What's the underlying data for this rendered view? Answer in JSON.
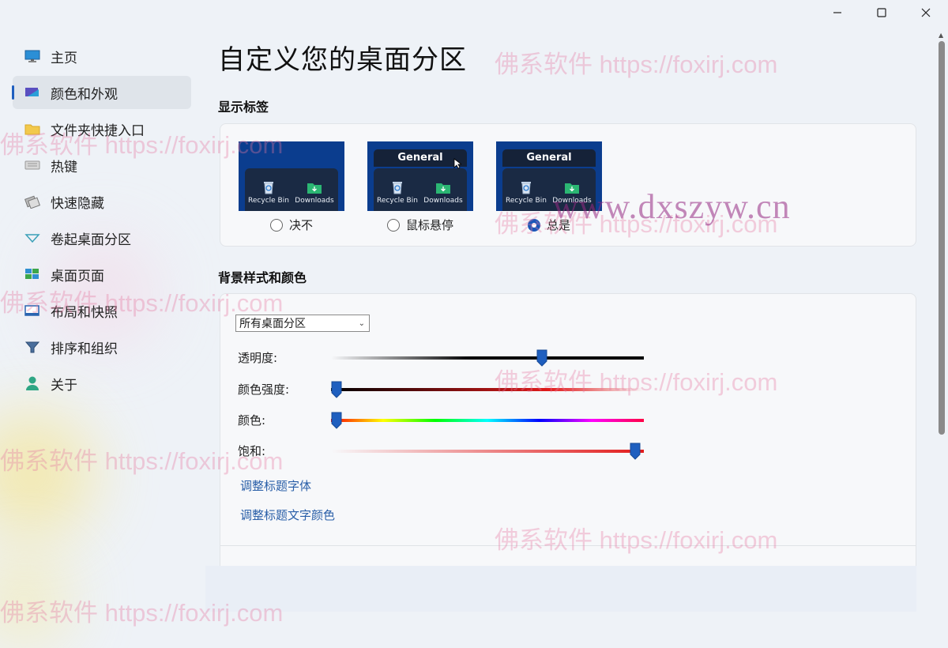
{
  "window": {
    "controls": [
      "minimize",
      "maximize",
      "close"
    ]
  },
  "sidebar": {
    "items": [
      {
        "label": "主页",
        "icon": "monitor-icon",
        "active": false
      },
      {
        "label": "颜色和外观",
        "icon": "palette-icon",
        "active": true
      },
      {
        "label": "文件夹快捷入口",
        "icon": "folder-icon",
        "active": false
      },
      {
        "label": "热键",
        "icon": "keyboard-icon",
        "active": false
      },
      {
        "label": "快速隐藏",
        "icon": "quick-hide-icon",
        "active": false
      },
      {
        "label": "卷起桌面分区",
        "icon": "rollup-icon",
        "active": false
      },
      {
        "label": "桌面页面",
        "icon": "desktop-pages-icon",
        "active": false
      },
      {
        "label": "布局和快照",
        "icon": "layout-icon",
        "active": false
      },
      {
        "label": "排序和组织",
        "icon": "sort-filter-icon",
        "active": false
      },
      {
        "label": "关于",
        "icon": "person-icon",
        "active": false
      }
    ]
  },
  "main": {
    "title": "自定义您的桌面分区",
    "labels_section": {
      "title": "显示标签",
      "options": [
        {
          "label": "决不",
          "header": "",
          "selected": false
        },
        {
          "label": "鼠标悬停",
          "header": "General",
          "selected": false
        },
        {
          "label": "总是",
          "header": "General",
          "selected": true
        }
      ],
      "thumb_icons": {
        "recycle": "Recycle Bin",
        "downloads": "Downloads"
      }
    },
    "background_section": {
      "title": "背景样式和颜色",
      "select_value": "所有桌面分区",
      "sliders": [
        {
          "label": "透明度:",
          "value": 0.68
        },
        {
          "label": "颜色强度:",
          "value": 0.0
        },
        {
          "label": "颜色:",
          "value": 0.0
        },
        {
          "label": "饱和:",
          "value": 0.99
        }
      ],
      "links": [
        "调整标题字体",
        "调整标题文字颜色"
      ]
    }
  },
  "watermarks": {
    "site": "佛系软件 https://foxirj.com",
    "domain": "www.dxszyw.cn"
  },
  "colors": {
    "accent": "#1a56b8",
    "thumb_bg": "#0b3d8e",
    "link": "#2a5fa8"
  }
}
